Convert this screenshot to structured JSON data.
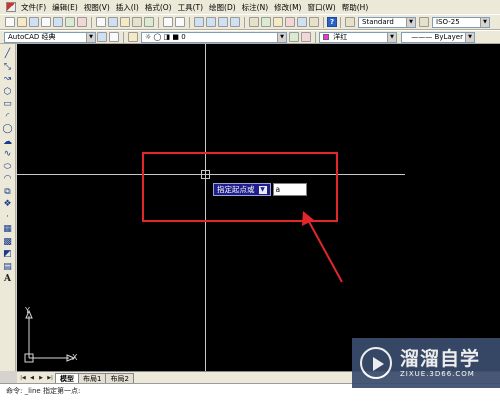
{
  "menubar": {
    "items": [
      "文件(F)",
      "编辑(E)",
      "视图(V)",
      "插入(I)",
      "格式(O)",
      "工具(T)",
      "绘图(D)",
      "标注(N)",
      "修改(M)",
      "窗口(W)",
      "帮助(H)"
    ]
  },
  "toolbar1": {
    "text_style": "Standard",
    "dim_style": "ISO-25",
    "help_label": "?"
  },
  "toolbar2": {
    "workspace": "AutoCAD 经典",
    "layer": "0",
    "color": "洋红",
    "color_hex": "#ff2be0",
    "linetype": "ByLayer"
  },
  "left_toolbar": {
    "icons": [
      "line-icon",
      "construction-line-icon",
      "polyline-icon",
      "polygon-icon",
      "rectangle-icon",
      "arc-icon",
      "circle-icon",
      "revision-cloud-icon",
      "spline-icon",
      "ellipse-icon",
      "ellipse-arc-icon",
      "insert-block-icon",
      "make-block-icon",
      "point-icon",
      "hatch-icon",
      "gradient-icon",
      "region-icon",
      "table-icon",
      "multiline-text-icon"
    ],
    "text_tool_label": "A"
  },
  "dynamic_input": {
    "prompt": "指定起点或",
    "dropdown_glyph": "▼",
    "value": "a"
  },
  "ucs": {
    "y_label": "Y",
    "x_label": "X"
  },
  "tabs": {
    "nav": [
      "|◀",
      "◀",
      "▶",
      "▶|"
    ],
    "items": [
      "模型",
      "布局1",
      "布局2"
    ],
    "active_index": 0
  },
  "command": {
    "text": "命令: _line 指定第一点:"
  },
  "watermark": {
    "title": "溜溜自学",
    "subtitle": "ZIXUE.3D66.COM"
  },
  "annotation": {
    "highlight_color": "#e3262c"
  }
}
